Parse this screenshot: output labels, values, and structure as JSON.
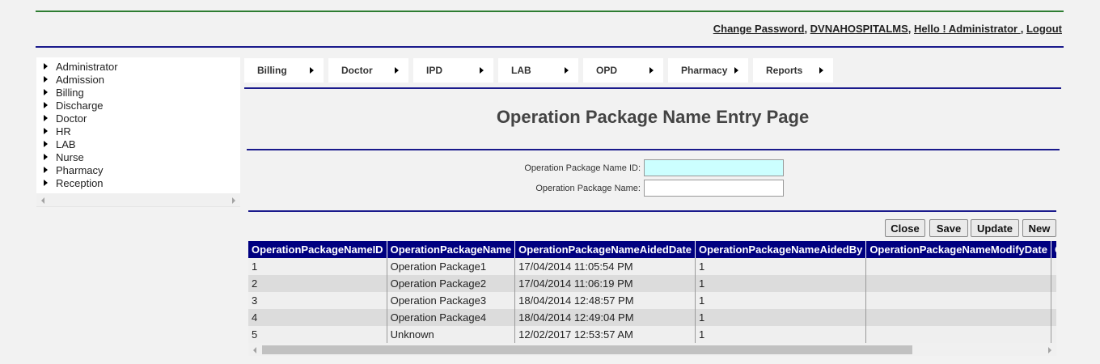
{
  "header": {
    "links": [
      {
        "label": "Change Password"
      },
      {
        "label": "DVNAHOSPITALMS"
      },
      {
        "label": "Hello ! Administrator "
      },
      {
        "label": "Logout"
      }
    ]
  },
  "sidebar": {
    "items": [
      {
        "label": "Administrator"
      },
      {
        "label": "Admission"
      },
      {
        "label": "Billing"
      },
      {
        "label": "Discharge"
      },
      {
        "label": "Doctor"
      },
      {
        "label": "HR"
      },
      {
        "label": "LAB"
      },
      {
        "label": "Nurse"
      },
      {
        "label": "Pharmacy"
      },
      {
        "label": "Reception"
      }
    ]
  },
  "menu": {
    "items": [
      {
        "label": "Billing"
      },
      {
        "label": "Doctor"
      },
      {
        "label": "IPD"
      },
      {
        "label": "LAB"
      },
      {
        "label": "OPD"
      },
      {
        "label": "Pharmacy"
      },
      {
        "label": "Reports"
      }
    ]
  },
  "page": {
    "title": "Operation Package Name Entry Page"
  },
  "form": {
    "id_label": "Operation Package Name ID:",
    "id_value": "",
    "name_label": "Operation Package Name:",
    "name_value": ""
  },
  "buttons": {
    "close": "Close",
    "save": "Save",
    "update": "Update",
    "new": "New"
  },
  "grid": {
    "columns": [
      "OperationPackageNameID",
      "OperationPackageName",
      "OperationPackageNameAidedDate",
      "OperationPackageNameAidedBy",
      "OperationPackageNameModifyDate",
      "O"
    ],
    "rows": [
      [
        "1",
        "Operation Package1",
        "17/04/2014 11:05:54 PM",
        "1",
        "",
        ""
      ],
      [
        "2",
        "Operation Package2",
        "17/04/2014 11:06:19 PM",
        "1",
        "",
        ""
      ],
      [
        "3",
        "Operation Package3",
        "18/04/2014 12:48:57 PM",
        "1",
        "",
        ""
      ],
      [
        "4",
        "Operation Package4",
        "18/04/2014 12:49:04 PM",
        "1",
        "",
        ""
      ],
      [
        "5",
        "Unknown",
        "12/02/2017 12:53:57 AM",
        "1",
        "",
        ""
      ]
    ]
  },
  "colors": {
    "header_line": "#1a1a8c",
    "top_line": "#2e7d32",
    "grid_header_bg": "#000080",
    "id_input_bg": "#ccffff"
  }
}
